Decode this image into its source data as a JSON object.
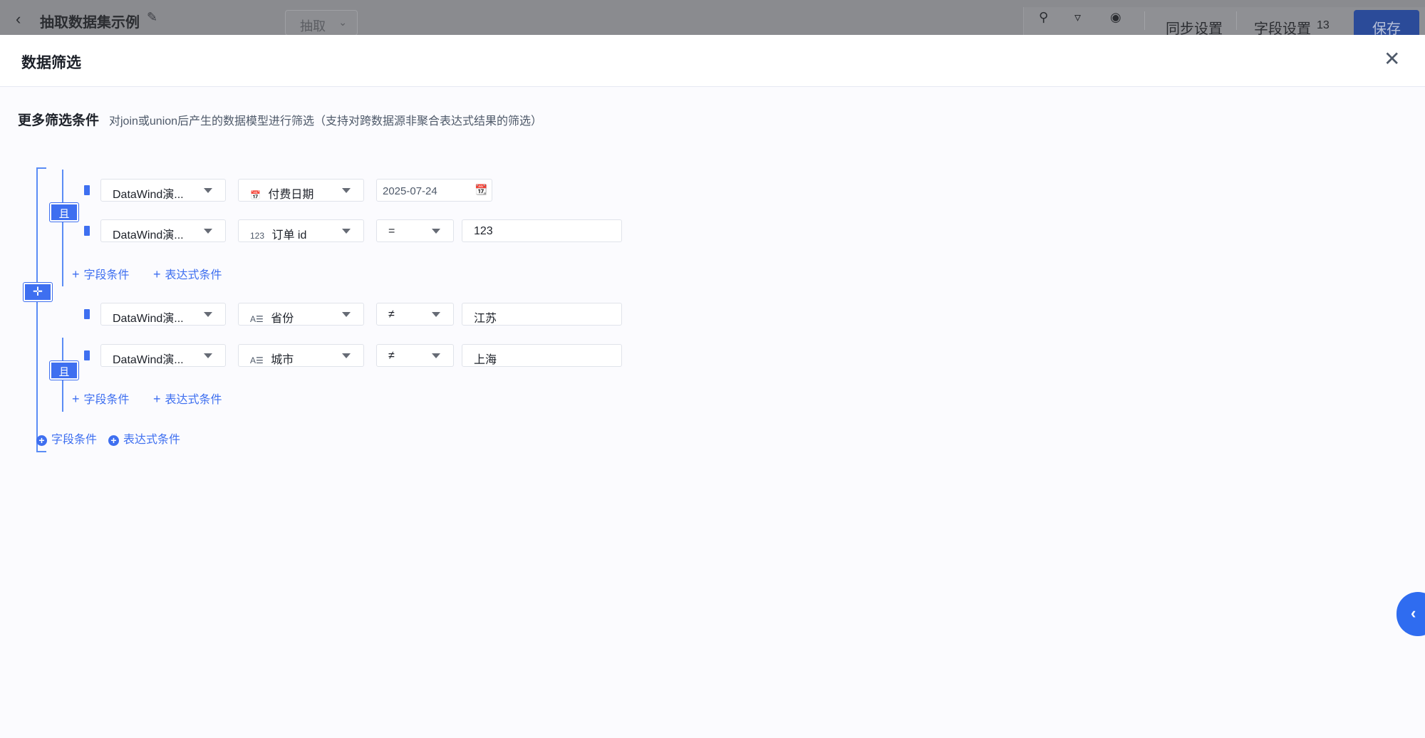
{
  "topbar": {
    "back_icon": "chevron-left-icon",
    "title": "抽取数据集示例",
    "extract_label": "抽取",
    "sync_label": "同步设置",
    "field_settings_label": "字段设置",
    "field_count": "13",
    "save_label": "保存"
  },
  "drawer": {
    "title": "数据筛选",
    "section_title": "更多筛选条件",
    "section_desc": "对join或union后产生的数据模型进行筛选（支持对跨数据源非聚合表达式结果的筛选）",
    "and_label": "且",
    "groups": [
      {
        "rows": [
          {
            "source": "DataWind演...",
            "field_icon": "date-field-icon",
            "field": "付费日期",
            "date_value": "2025-07-24"
          },
          {
            "source": "DataWind演...",
            "field_icon": "number-field-icon",
            "field": "订单 id",
            "operator": "=",
            "value": "123"
          }
        ],
        "add_field": "字段条件",
        "add_expr": "表达式条件"
      },
      {
        "rows": [
          {
            "source": "DataWind演...",
            "field_icon": "text-field-icon",
            "field": "省份",
            "operator": "≠",
            "value": "江苏"
          },
          {
            "source": "DataWind演...",
            "field_icon": "text-field-icon",
            "field": "城市",
            "operator": "≠",
            "value": "上海"
          }
        ],
        "add_field": "字段条件",
        "add_expr": "表达式条件"
      }
    ],
    "root_add_field": "字段条件",
    "root_add_expr": "表达式条件"
  },
  "glyphs": {
    "number_field": "123",
    "text_field": "A☰"
  },
  "colors": {
    "accent": "#3e6ff0",
    "overlay": "#8a8b8f"
  }
}
